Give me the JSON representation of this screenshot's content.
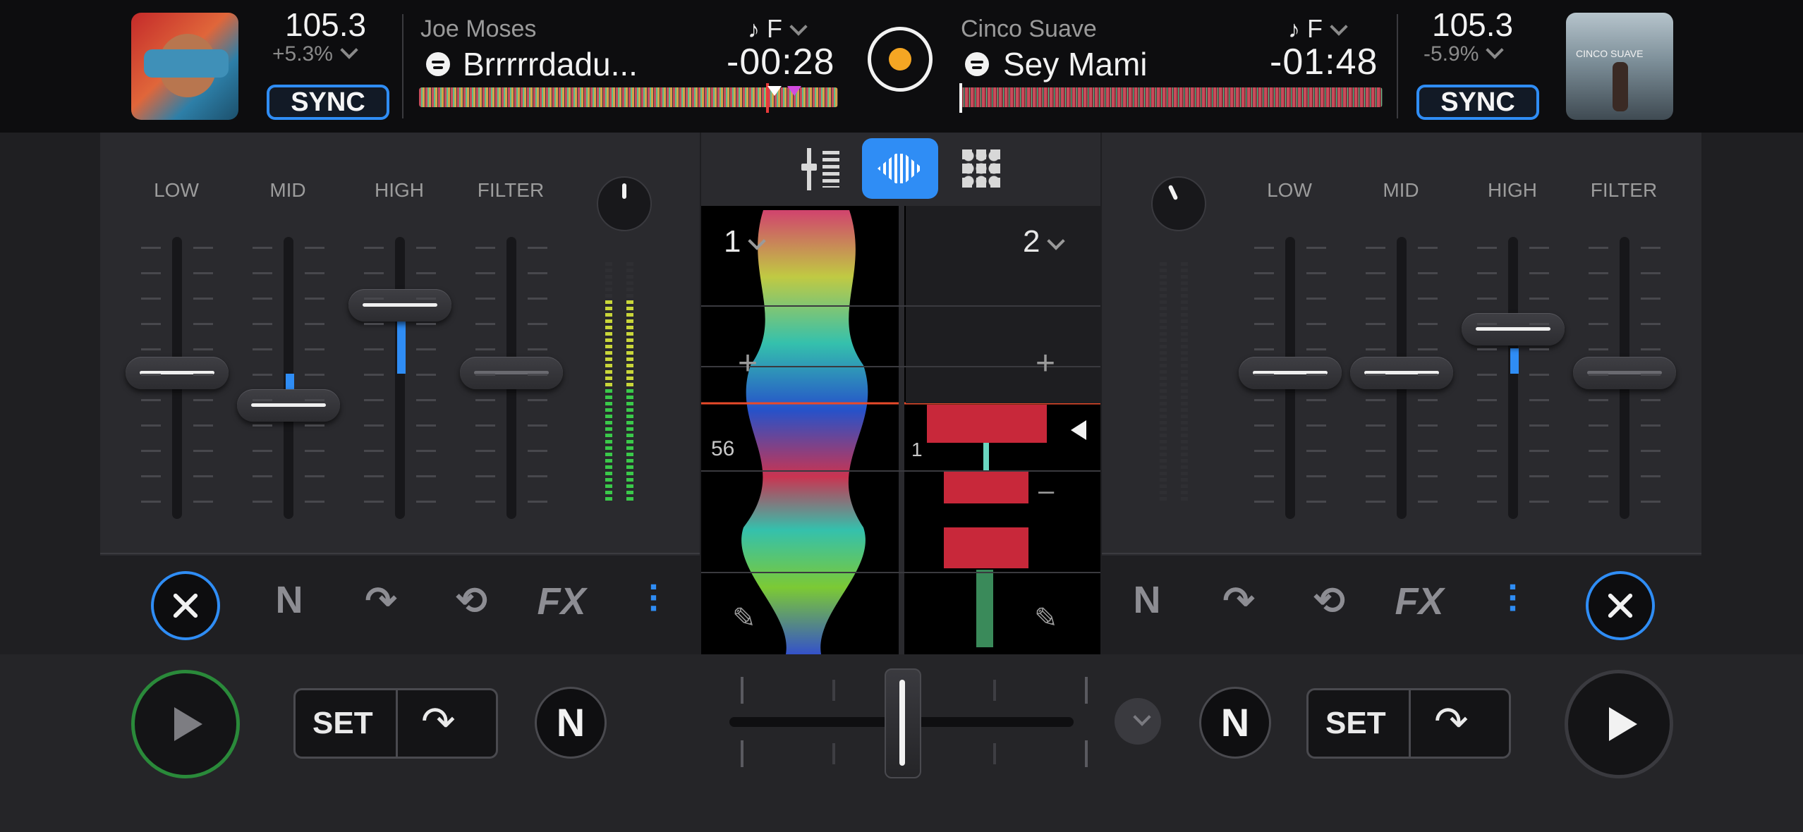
{
  "deck_left": {
    "bpm": "105.3",
    "pitch": "+5.3%",
    "sync_label": "SYNC",
    "artist": "Joe Moses",
    "title": "Brrrrrdadu...",
    "time": "-00:28",
    "key": "F"
  },
  "deck_right": {
    "bpm": "105.3",
    "pitch": "-5.9%",
    "sync_label": "SYNC",
    "artist": "Cinco Suave",
    "title": "Sey Mami",
    "time": "-01:48",
    "key": "F",
    "art_text": "CINCO SUAVE"
  },
  "eq_left": {
    "low": "LOW",
    "mid": "MID",
    "high": "HIGH",
    "filter": "FILTER"
  },
  "eq_right": {
    "low": "LOW",
    "mid": "MID",
    "high": "HIGH",
    "filter": "FILTER"
  },
  "waveform": {
    "deck1_label": "1",
    "deck2_label": "2",
    "beat_left": "56",
    "beat_right": "1"
  },
  "transport": {
    "set_left": "SET",
    "set_right": "SET"
  },
  "colors": {
    "accent": "#2f8df5",
    "play_ring_left": "#2a8a3a",
    "record": "#f5a623"
  }
}
